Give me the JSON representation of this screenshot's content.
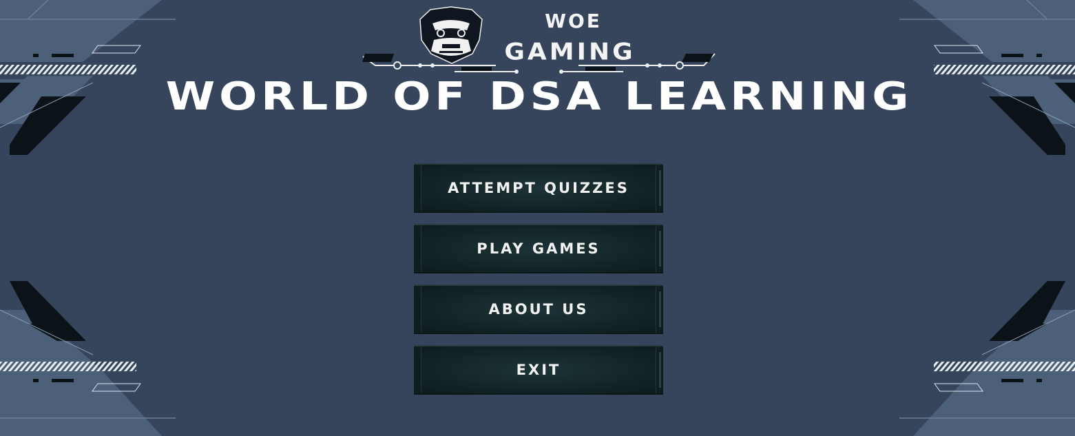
{
  "brand": {
    "top": "WOE",
    "sub": "GAMING"
  },
  "title": "WORLD OF DSA LEARNING",
  "menu": [
    {
      "label": "ATTEMPT QUIZZES"
    },
    {
      "label": "PLAY GAMES"
    },
    {
      "label": "ABOUT US"
    },
    {
      "label": "EXIT"
    }
  ],
  "icons": [
    "gorilla-logo-icon"
  ],
  "colors": {
    "background": "#36455c",
    "panel": "#4a5d73",
    "button": "#112226",
    "text": "#ffffff"
  }
}
